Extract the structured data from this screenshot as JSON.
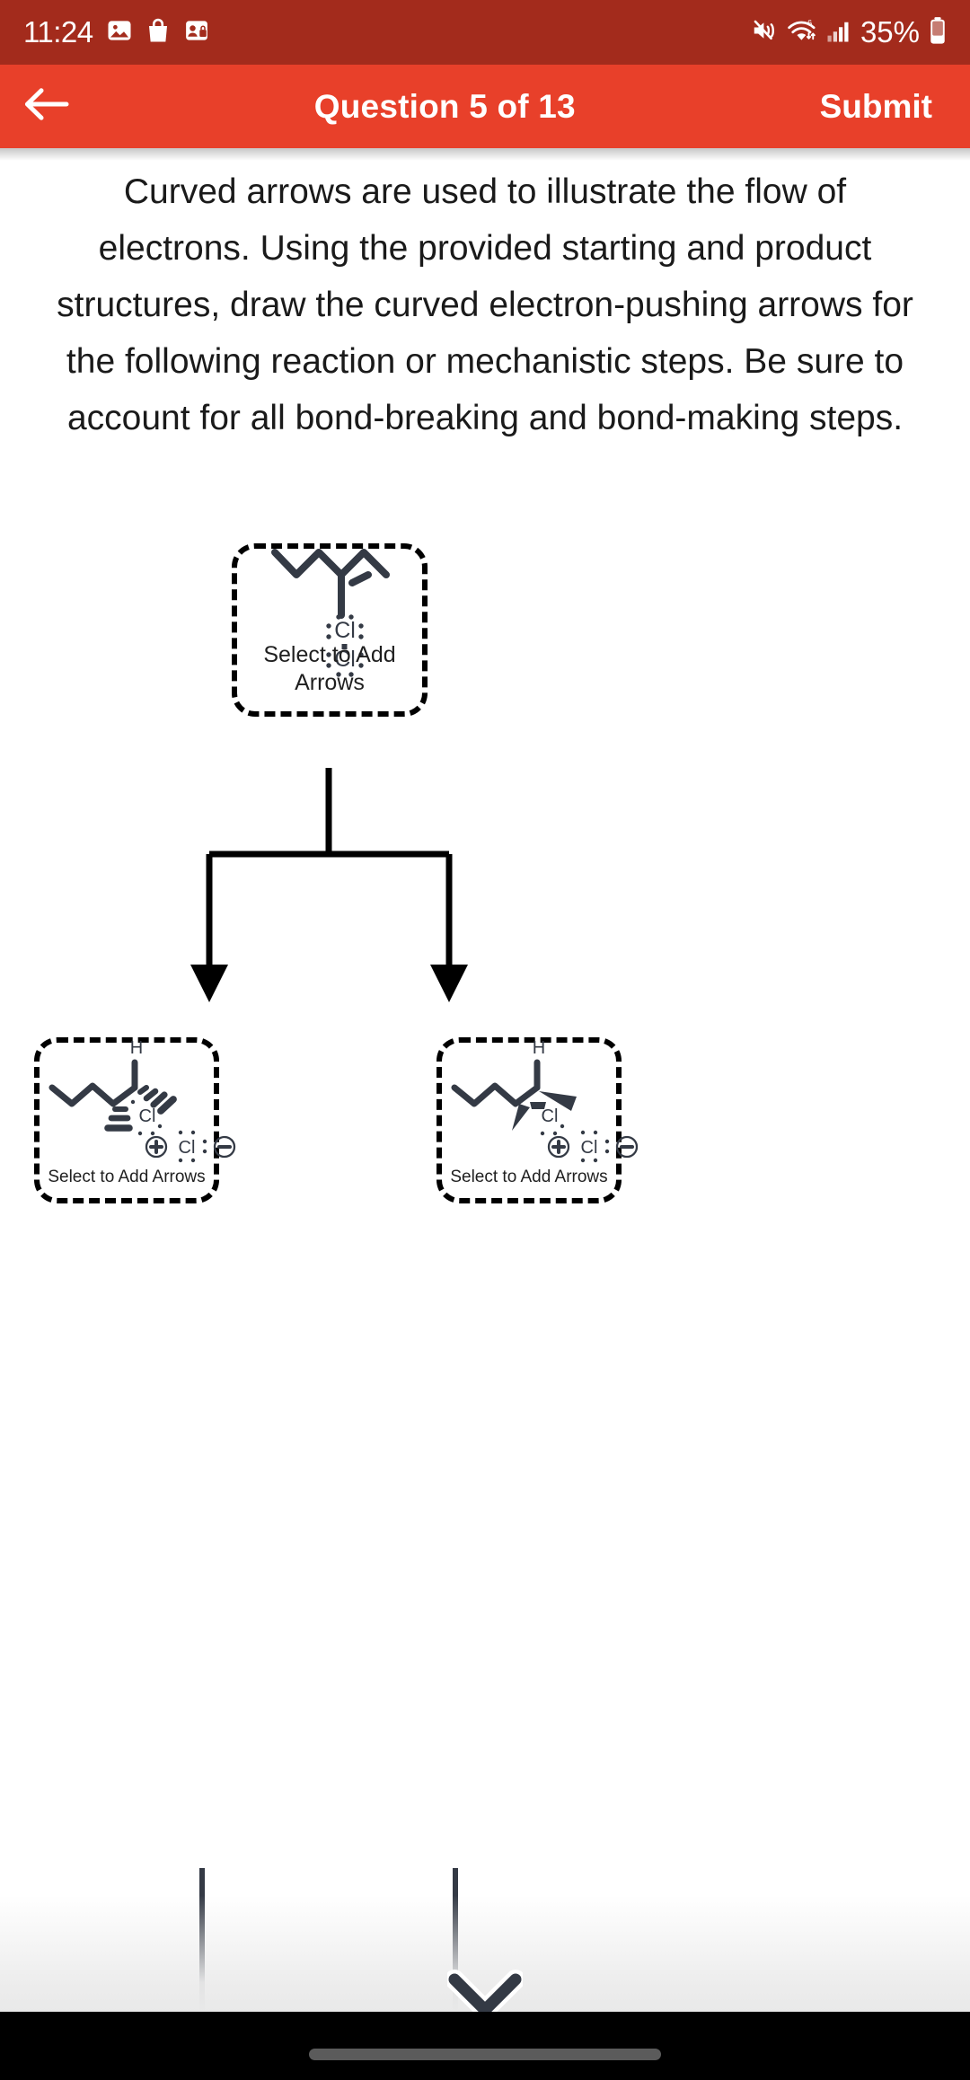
{
  "status_bar": {
    "time": "11:24",
    "battery_percent": "35%",
    "icons": [
      "image-icon",
      "shopping-bag-icon",
      "contact-card-icon",
      "mute-icon",
      "wifi-icon",
      "cellular-signal-icon",
      "battery-icon"
    ],
    "background_color": "#a32b1c"
  },
  "app_bar": {
    "back_label": "back-arrow",
    "title": "Question 5 of 13",
    "submit_label": "Submit",
    "background_color": "#e8402a",
    "text_color": "#ffffff"
  },
  "prompt": {
    "text": "Curved arrows are used to illustrate the flow of electrons. Using the provided starting and product structures, draw the curved electron-pushing arrows for the following reaction or mechanistic steps. Be sure to account for all bond-breaking and bond-making steps."
  },
  "mechanism": {
    "bond_color": "#343a45",
    "arrow_color": "#000000",
    "boxes": [
      {
        "id": "starting-structure",
        "role": "reactant",
        "hint": "Select to Add Arrows",
        "hint_lines": [
          "Select to Add",
          "Arrows"
        ],
        "atom_labels": [
          "Cl",
          "Cl"
        ],
        "charges": [],
        "description": "alkene chain with chlorine molecule"
      },
      {
        "id": "product-left",
        "role": "product",
        "hint": "Select to Add Arrows",
        "hint_lines": [
          "Select to Add Arrows"
        ],
        "atom_labels": [
          "H",
          "Cl",
          "Cl"
        ],
        "charges": [
          "⊕",
          "⊖"
        ],
        "description": "chloronium intermediate, hashed wedge stereochemistry, with chloride counterion"
      },
      {
        "id": "product-right",
        "role": "product",
        "hint": "Select to Add Arrows",
        "hint_lines": [
          "Select to Add Arrows"
        ],
        "atom_labels": [
          "H",
          "Cl",
          "Cl"
        ],
        "charges": [
          "⊕",
          "⊖"
        ],
        "description": "chloronium intermediate, solid wedge stereochemistry, with chloride counterion"
      }
    ]
  },
  "scroll": {
    "chevron_icon": "chevron-down-icon"
  },
  "nav_bar": {
    "gesture_pill": "home-gesture-pill",
    "background_color": "#000000"
  }
}
